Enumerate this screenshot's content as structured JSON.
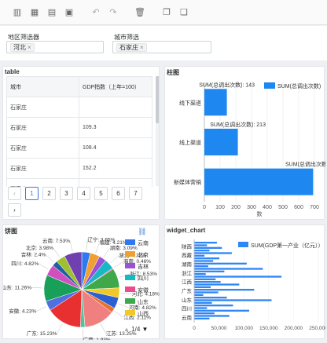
{
  "toolbar": {
    "icons": [
      "bar-chart-icon",
      "grid-layout-icon",
      "filter-form-icon",
      "chart-widget-icon",
      "undo-icon",
      "redo-icon",
      "trash-icon",
      "copy-icon",
      "paste-icon"
    ]
  },
  "filters": {
    "region": {
      "label": "地区筛选器",
      "tag": "河北"
    },
    "city": {
      "label": "城市筛选",
      "tag": "石家庄"
    }
  },
  "table_panel": {
    "title": "table",
    "headers": [
      "城市",
      "GDP指数（上年=100）"
    ],
    "rows": [
      [
        "石家庄",
        ""
      ],
      [
        "石家庄",
        "109.3"
      ],
      [
        "石家庄",
        "108.4"
      ],
      [
        "石家庄",
        "152.2"
      ],
      [
        "石家庄",
        "..."
      ]
    ],
    "pages": [
      "1",
      "2",
      "3",
      "4",
      "5",
      "6",
      "7"
    ],
    "active_page": "1"
  },
  "bar_panel": {
    "title": "柱图"
  },
  "pie_panel": {
    "title": "饼图",
    "pager": "1/4"
  },
  "widget_panel": {
    "title": "widget_chart"
  },
  "colors": {
    "accent": "#3a7bd5",
    "bar": "#1e88f0",
    "series": "#2f86f6"
  },
  "chart_data": [
    {
      "type": "bar",
      "orientation": "horizontal",
      "categories": [
        "线下渠道",
        "线上渠道",
        "新媒体营销"
      ],
      "series": [
        {
          "name": "SUM(总调出次数)",
          "values": [
            143,
            213,
            692
          ]
        }
      ],
      "data_labels": [
        "SUM(总调出次数): 143",
        "SUM(总调出次数): 213",
        "SUM(总调出次数): 692"
      ],
      "xlabel": "数",
      "xlim": [
        0,
        700
      ],
      "xticks": [
        0,
        100,
        200,
        300,
        400,
        500,
        600,
        700
      ],
      "legend": "top-right"
    },
    {
      "type": "pie",
      "slices": [
        {
          "label": "辽宁",
          "pct": 3.65,
          "color": "#2f78f0"
        },
        {
          "label": "福建",
          "pct": 4.21,
          "color": "#f0a030"
        },
        {
          "label": "湖南",
          "pct": 3.09,
          "color": "#9c50d8"
        },
        {
          "label": "湖北",
          "pct": 4.32,
          "color": "#16b8c4"
        },
        {
          "label": "海南",
          "pct": 0.46,
          "color": "#ec4c8c"
        },
        {
          "label": "浙江",
          "pct": 8.53,
          "color": "#3fa84a"
        },
        {
          "label": "河北",
          "pct": 4.18,
          "color": "#f0c828"
        },
        {
          "label": "河南",
          "pct": 4.82,
          "color": "#2c5fd0"
        },
        {
          "label": "江西",
          "pct": 2.11,
          "color": "#e8702e"
        },
        {
          "label": "江苏",
          "pct": 13.25,
          "color": "#f08080"
        },
        {
          "label": "广西",
          "pct": 1.93,
          "color": "#55c0a0"
        },
        {
          "label": "广东",
          "pct": 15.23,
          "color": "#e83030"
        },
        {
          "label": "安徽",
          "pct": 4.23,
          "color": "#5070e0"
        },
        {
          "label": "山东",
          "pct": 11.26,
          "color": "#18a058"
        },
        {
          "label": "四川",
          "pct": 4.82,
          "color": "#d050c0"
        },
        {
          "label": "吉林",
          "pct": 2.4,
          "color": "#2060a0"
        },
        {
          "label": "北京",
          "pct": 3.98,
          "color": "#a0c030"
        },
        {
          "label": "云南",
          "pct": 7.53,
          "color": "#7040b0"
        }
      ],
      "legend": [
        {
          "label": "云南",
          "color": "#2f78f0"
        },
        {
          "label": "北京",
          "color": "#f0a030"
        },
        {
          "label": "吉林",
          "color": "#9c50d8"
        },
        {
          "label": "四川",
          "color": "#16b8c4"
        },
        {
          "label": "安徽",
          "color": "#ec4c8c"
        },
        {
          "label": "山东",
          "color": "#3fa84a"
        },
        {
          "label": "山西",
          "color": "#f0c828"
        }
      ],
      "legend_position": "right"
    },
    {
      "type": "bar",
      "orientation": "horizontal",
      "categories": [
        "云南",
        "四川",
        "山东",
        "广东",
        "江西",
        "浙江",
        "湖南",
        "西藏",
        "陕西"
      ],
      "series": [
        {
          "name": "SUM(GDP第一产业（亿元））",
          "values": []
        }
      ],
      "xlim": [
        0,
        250000
      ],
      "xticks": [
        "0",
        "50,000",
        "100,000",
        "150,000",
        "200,000",
        "250,000"
      ],
      "legend": "top-right"
    }
  ]
}
